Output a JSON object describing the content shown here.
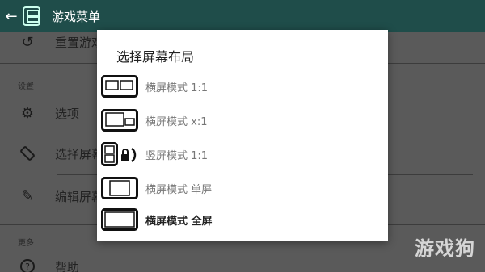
{
  "appbar": {
    "title": "游戏菜单"
  },
  "menu": {
    "partial_top_item": "重置游戏",
    "section_settings": "设置",
    "item_options": "选项",
    "item_select_layout": "选择屏幕布局",
    "item_edit_layout": "编辑屏幕布局",
    "section_more": "更多",
    "item_help": "帮助"
  },
  "dialog": {
    "title": "选择屏幕布局",
    "options": [
      {
        "label": "横屏模式 1:1",
        "icon": "two-screens-side-by-side-equal"
      },
      {
        "label": "横屏模式 x:1",
        "icon": "two-screens-side-by-side-large-small"
      },
      {
        "label": "竖屏模式 1:1",
        "icon": "two-screens-stacked-rotation-lock"
      },
      {
        "label": "横屏模式 单屏",
        "icon": "single-screen-framed"
      },
      {
        "label": "横屏模式 全屏",
        "icon": "single-screen-full"
      }
    ],
    "selected_index": 4
  },
  "watermark": "游戏狗"
}
